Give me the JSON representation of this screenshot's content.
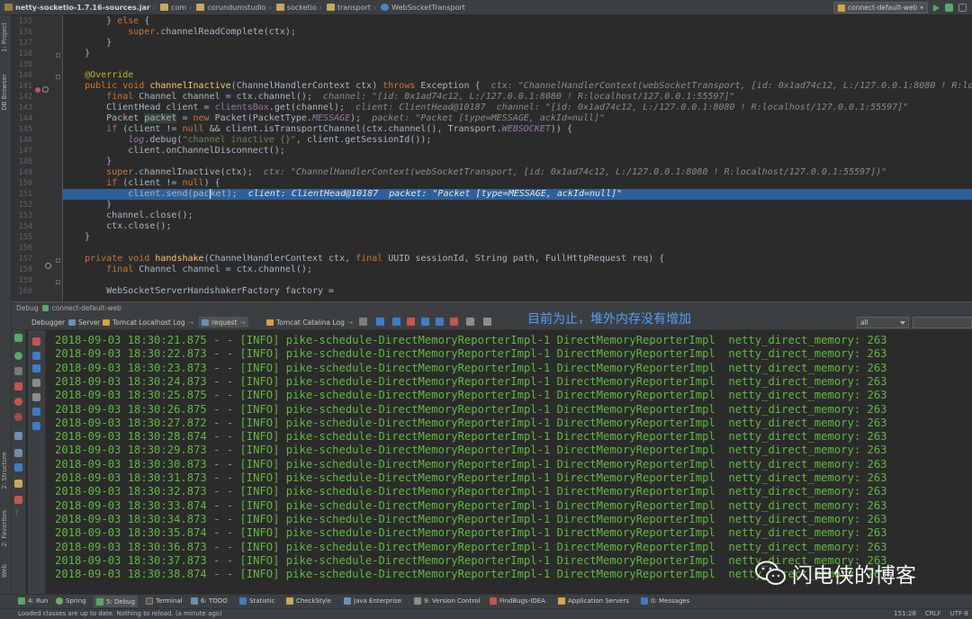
{
  "breadcrumb": {
    "items": [
      {
        "label": "netty-socketio-1.7.16-sources.jar",
        "icon": "jar-icon"
      },
      {
        "label": "com",
        "icon": "package-icon"
      },
      {
        "label": "corundumstudio",
        "icon": "package-icon"
      },
      {
        "label": "socketio",
        "icon": "package-icon"
      },
      {
        "label": "transport",
        "icon": "package-icon"
      },
      {
        "label": "WebSocketTransport",
        "icon": "class-icon"
      }
    ]
  },
  "toolbar": {
    "run_config": "connect-default-web"
  },
  "left_stripe": {
    "tabs": [
      "1: Project",
      "DB Browser",
      "2: Structure",
      "2: Favorites",
      "Web"
    ]
  },
  "editor": {
    "line_numbers": [
      "135",
      "136",
      "137",
      "138",
      "139",
      "140",
      "141",
      "142",
      "143",
      "144",
      "145",
      "146",
      "147",
      "148",
      "149",
      "150",
      "151",
      "152",
      "153",
      "154",
      "155",
      "156",
      "157",
      "158",
      "159",
      "160"
    ],
    "highlight_line": "151"
  },
  "debug_panel": {
    "title": "Debug",
    "session": "connect-default-web",
    "tabs": [
      "Debugger",
      "Server",
      "Tomcat Localhost Log",
      "request",
      "Tomcat Catalina Log"
    ],
    "annotation": "目前为止，堆外内存没有增加",
    "filter_value": "all"
  },
  "console": {
    "lines": [
      "2018-09-03 18:30:21.875 - - [INFO] pike-schedule-DirectMemoryReporterImpl-1 DirectMemoryReporterImpl  netty_direct_memory: 263",
      "2018-09-03 18:30:22.873 - - [INFO] pike-schedule-DirectMemoryReporterImpl-1 DirectMemoryReporterImpl  netty_direct_memory: 263",
      "2018-09-03 18:30:23.873 - - [INFO] pike-schedule-DirectMemoryReporterImpl-1 DirectMemoryReporterImpl  netty_direct_memory: 263",
      "2018-09-03 18:30:24.873 - - [INFO] pike-schedule-DirectMemoryReporterImpl-1 DirectMemoryReporterImpl  netty_direct_memory: 263",
      "2018-09-03 18:30:25.875 - - [INFO] pike-schedule-DirectMemoryReporterImpl-1 DirectMemoryReporterImpl  netty_direct_memory: 263",
      "2018-09-03 18:30:26.875 - - [INFO] pike-schedule-DirectMemoryReporterImpl-1 DirectMemoryReporterImpl  netty_direct_memory: 263",
      "2018-09-03 18:30:27.872 - - [INFO] pike-schedule-DirectMemoryReporterImpl-1 DirectMemoryReporterImpl  netty_direct_memory: 263",
      "2018-09-03 18:30:28.874 - - [INFO] pike-schedule-DirectMemoryReporterImpl-1 DirectMemoryReporterImpl  netty_direct_memory: 263",
      "2018-09-03 18:30:29.873 - - [INFO] pike-schedule-DirectMemoryReporterImpl-1 DirectMemoryReporterImpl  netty_direct_memory: 263",
      "2018-09-03 18:30:30.873 - - [INFO] pike-schedule-DirectMemoryReporterImpl-1 DirectMemoryReporterImpl  netty_direct_memory: 263",
      "2018-09-03 18:30:31.873 - - [INFO] pike-schedule-DirectMemoryReporterImpl-1 DirectMemoryReporterImpl  netty_direct_memory: 263",
      "2018-09-03 18:30:32.873 - - [INFO] pike-schedule-DirectMemoryReporterImpl-1 DirectMemoryReporterImpl  netty_direct_memory: 263",
      "2018-09-03 18:30:33.874 - - [INFO] pike-schedule-DirectMemoryReporterImpl-1 DirectMemoryReporterImpl  netty_direct_memory: 263",
      "2018-09-03 18:30:34.873 - - [INFO] pike-schedule-DirectMemoryReporterImpl-1 DirectMemoryReporterImpl  netty_direct_memory: 263",
      "2018-09-03 18:30:35.874 - - [INFO] pike-schedule-DirectMemoryReporterImpl-1 DirectMemoryReporterImpl  netty_direct_memory: 263",
      "2018-09-03 18:30:36.873 - - [INFO] pike-schedule-DirectMemoryReporterImpl-1 DirectMemoryReporterImpl  netty_direct_memory: 263",
      "2018-09-03 18:30:37.873 - - [INFO] pike-schedule-DirectMemoryReporterImpl-1 DirectMemoryReporterImpl  netty_direct_memory: 263",
      "2018-09-03 18:30:38.874 - - [INFO] pike-schedule-DirectMemoryReporterImpl-1 DirectMemoryReporterImpl  netty_direct_memory: 263"
    ]
  },
  "watermark": "闪电侠的博客",
  "tool_windows": [
    {
      "label": "4: Run",
      "icon": "run-icon"
    },
    {
      "label": "Spring",
      "icon": "spring-icon"
    },
    {
      "label": "5: Debug",
      "icon": "debug-icon"
    },
    {
      "label": "Terminal",
      "icon": "terminal-icon"
    },
    {
      "label": "6: TODO",
      "icon": "todo-icon"
    },
    {
      "label": "Statistic",
      "icon": "statistic-icon"
    },
    {
      "label": "CheckStyle",
      "icon": "checkstyle-icon"
    },
    {
      "label": "Java Enterprise",
      "icon": "java-enterprise-icon"
    },
    {
      "label": "9: Version Control",
      "icon": "version-control-icon"
    },
    {
      "label": "FindBugs-IDEA",
      "icon": "findbugs-icon"
    },
    {
      "label": "Application Servers",
      "icon": "app-servers-icon"
    },
    {
      "label": "0: Messages",
      "icon": "messages-icon"
    }
  ],
  "status_bar": {
    "message": "Loaded classes are up to date. Nothing to reload. (a minute ago)",
    "position": "151:28",
    "line_separator": "CRLF",
    "encoding": "UTF-8"
  },
  "colors": {
    "background": "#2b2b2b",
    "log_text": "#5fba3e",
    "highlight": "#2d6099",
    "annotation": "#4ea1ff"
  }
}
